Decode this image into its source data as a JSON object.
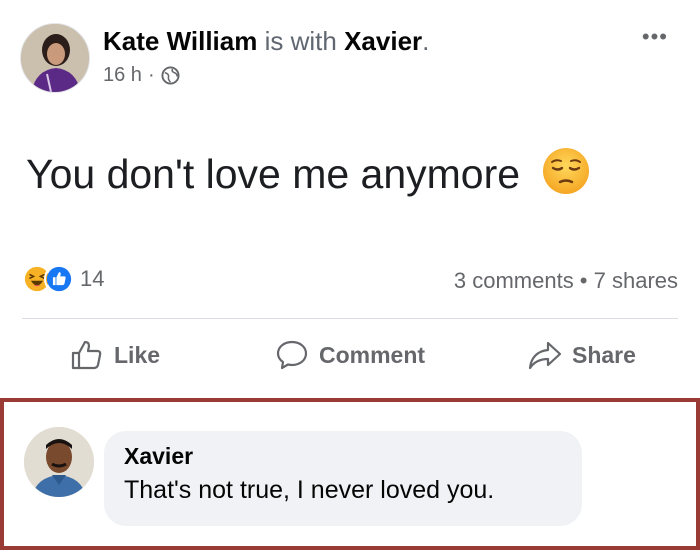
{
  "post": {
    "author": "Kate William",
    "with_text": "is with",
    "tagged": "Xavier",
    "tagged_suffix": ".",
    "time": "16 h",
    "separator": "·",
    "privacy_icon": "globe-icon",
    "more_icon": "more-options-icon",
    "more_label": "•••",
    "text": "You don't love me anymore",
    "emoji": "pensive-face-emoji",
    "reactions": {
      "icons": [
        "haha-reaction-icon",
        "like-reaction-icon"
      ],
      "count": "14"
    },
    "engagement": "3 comments • 7 shares",
    "actions": {
      "like": "Like",
      "comment": "Comment",
      "share": "Share"
    }
  },
  "comment": {
    "author": "Xavier",
    "text": "That's not true, I never loved you."
  },
  "colors": {
    "highlight_border": "#9b3b36",
    "like_blue": "#1877f2",
    "haha_yellow": "#f7b125",
    "secondary_text": "#65676b",
    "bubble_bg": "#f0f2f5"
  }
}
